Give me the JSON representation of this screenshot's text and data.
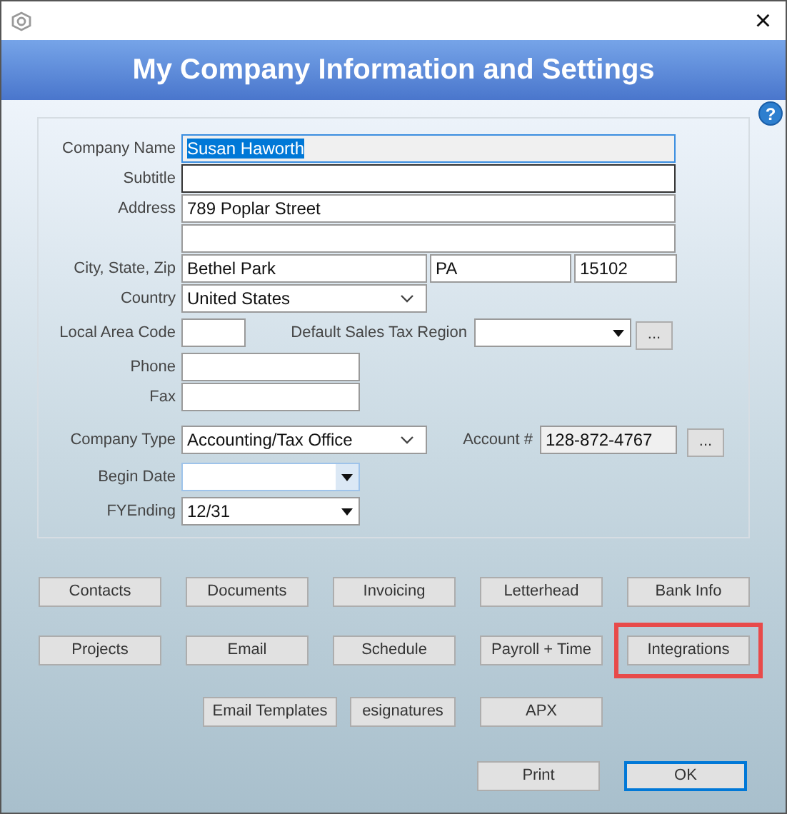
{
  "window": {
    "close": "×"
  },
  "banner": {
    "title": "My Company Information and Settings",
    "help": "?"
  },
  "form": {
    "rows": [
      {
        "label": "Company Name",
        "fields": [
          {
            "kind": "text",
            "value": "Susan Haworth",
            "text_selected": true,
            "readonly": true
          }
        ]
      },
      {
        "label": "Subtitle",
        "fields": [
          {
            "kind": "text",
            "focused": true
          }
        ]
      },
      {
        "label": "Address",
        "fields": [
          {
            "kind": "text",
            "value": "789 Poplar Street"
          }
        ]
      },
      {
        "fields": [
          {
            "kind": "text"
          }
        ]
      },
      {
        "label": "City, State, Zip",
        "fields": [
          {
            "kind": "text",
            "value": "Bethel Park"
          },
          {
            "kind": "text",
            "value": "PA"
          },
          {
            "kind": "text",
            "value": "15102"
          }
        ]
      },
      {
        "label": "Country",
        "fields": [
          {
            "kind": "combo",
            "value": "United States"
          }
        ]
      },
      {
        "label": "Local Area Code",
        "fields": [
          {
            "kind": "text"
          }
        ],
        "extra": {
          "label": "Default Sales Tax Region",
          "field": {
            "kind": "dropdown"
          },
          "button": "..."
        }
      },
      {
        "label": "Phone",
        "fields": [
          {
            "kind": "text"
          }
        ]
      },
      {
        "label": "Fax",
        "fields": [
          {
            "kind": "text"
          }
        ]
      },
      {
        "label": "Company Type",
        "fields": [
          {
            "kind": "combo",
            "value": "Accounting/Tax Office"
          }
        ],
        "extra": {
          "label": "Account #",
          "field": {
            "kind": "text",
            "value": "128-872-4767",
            "readonly": true
          },
          "button": "..."
        }
      },
      {
        "label": "Begin Date",
        "fields": [
          {
            "kind": "date"
          }
        ]
      },
      {
        "label": "FYEnding",
        "fields": [
          {
            "kind": "dropdown",
            "value": "12/31"
          }
        ]
      }
    ]
  },
  "buttons": [
    [
      {
        "label": "Contacts",
        "highlighted": false,
        "default": false
      },
      {
        "label": "Documents",
        "highlighted": false,
        "default": false
      },
      {
        "label": "Invoicing",
        "highlighted": false,
        "default": false
      },
      {
        "label": "Letterhead",
        "highlighted": false,
        "default": false
      },
      {
        "label": "Bank Info",
        "highlighted": false,
        "default": false
      }
    ],
    [
      {
        "label": "Projects",
        "highlighted": false,
        "default": false
      },
      {
        "label": "Email",
        "highlighted": false,
        "default": false
      },
      {
        "label": "Schedule",
        "highlighted": false,
        "default": false
      },
      {
        "label": "Payroll + Time",
        "highlighted": false,
        "default": false
      },
      {
        "label": "Integrations",
        "highlighted": true,
        "default": false
      }
    ],
    [
      {
        "label": "Email Templates",
        "highlighted": false,
        "default": false
      },
      {
        "label": "esignatures",
        "highlighted": false,
        "default": false
      },
      {
        "label": "APX",
        "highlighted": false,
        "default": false
      }
    ],
    [
      {
        "label": "Print",
        "highlighted": false,
        "default": false
      },
      {
        "label": "OK",
        "highlighted": false,
        "default": true
      }
    ]
  ]
}
